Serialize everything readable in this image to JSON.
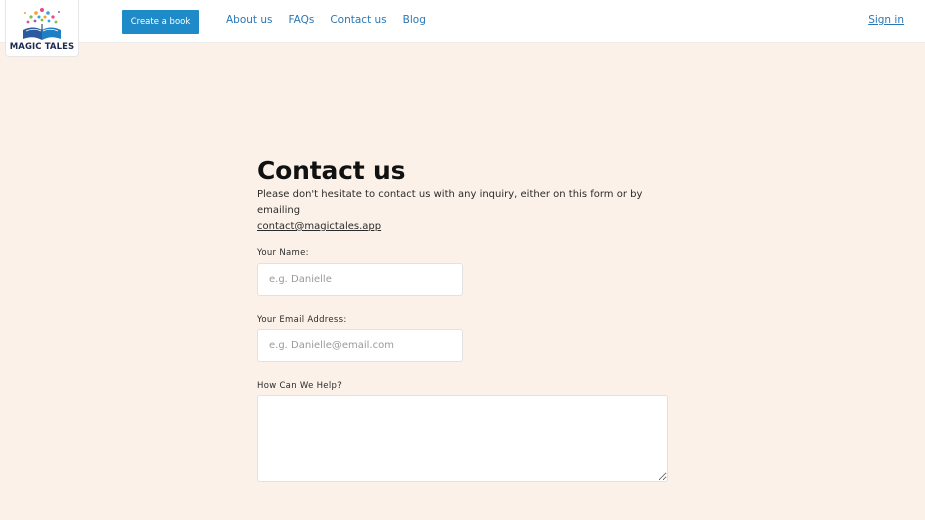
{
  "header": {
    "logo_text": "MAGIC TALES",
    "cta_label": "Create a book",
    "nav": [
      {
        "label": "About us"
      },
      {
        "label": "FAQs"
      },
      {
        "label": "Contact us"
      },
      {
        "label": "Blog"
      }
    ],
    "sign_in": "Sign in"
  },
  "main": {
    "title": "Contact us",
    "intro_text": "Please don't hesitate to contact us with any inquiry, either on this form or by emailing",
    "email_link": "contact@magictales.app",
    "form": {
      "name_label": "Your Name:",
      "name_placeholder": "e.g. Danielle",
      "name_value": "",
      "email_label": "Your Email Address:",
      "email_placeholder": "e.g. Danielle@email.com",
      "email_value": "",
      "help_label": "How Can We Help?",
      "help_value": ""
    }
  },
  "colors": {
    "page_background": "#fbf1e8",
    "header_background": "#ffffff",
    "button_accent": "#1f8ac8",
    "link_color": "#2a77b5"
  }
}
